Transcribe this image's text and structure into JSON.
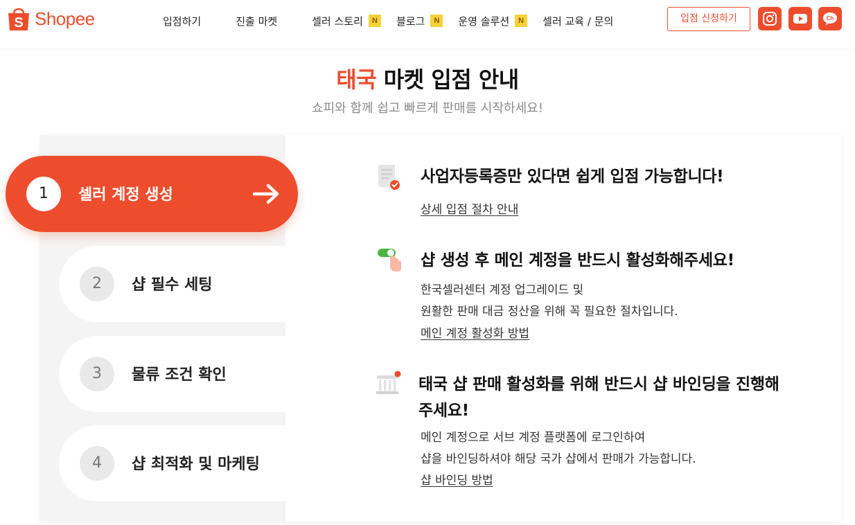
{
  "brand": {
    "name": "Shopee",
    "color": "#ee4d2d"
  },
  "nav": {
    "items": [
      {
        "label": "입점하기",
        "badge": ""
      },
      {
        "label": "진출 마켓",
        "badge": ""
      },
      {
        "label": "셀러 스토리",
        "badge": "N"
      },
      {
        "label": "블로그",
        "badge": "N"
      },
      {
        "label": "운영 솔루션",
        "badge": "N"
      },
      {
        "label": "셀러 교육 / 문의",
        "badge": ""
      }
    ],
    "apply_label": "입점 신청하기",
    "social_icons": [
      "instagram-icon",
      "youtube-icon",
      "kakao-channel-icon"
    ],
    "kakao_label": "Ch"
  },
  "hero": {
    "title_accent": "태국",
    "title_rest": "마켓 입점 안내",
    "subtitle": "쇼피와 함께 쉽고 빠르게 판매를 시작하세요!"
  },
  "steps": [
    {
      "num": "1",
      "label": "셀러 계정 생성",
      "active": true
    },
    {
      "num": "2",
      "label": "샵 필수 세팅",
      "active": false
    },
    {
      "num": "3",
      "label": "물류 조건 확인",
      "active": false
    },
    {
      "num": "4",
      "label": "샵 최적화 및 마케팅",
      "active": false
    }
  ],
  "content": [
    {
      "icon": "document-check-icon",
      "title": "사업자등록증만 있다면 쉽게 입점 가능합니다!",
      "text": [],
      "link": "상세 입점 절차 안내"
    },
    {
      "icon": "toggle-tap-icon",
      "title": "샵 생성 후 메인 계정을 반드시 활성화해주세요!",
      "text": [
        "한국셀러센터 계정 업그레이드 및",
        "원활한 판매 대금 정산을 위해 꼭 필요한 절차입니다."
      ],
      "link": "메인 계정 활성화 방법"
    },
    {
      "icon": "shop-binding-icon",
      "title_lines": [
        "태국 샵 판매 활성화를 위해 반드시 샵 바인딩을 진행해",
        "주세요!"
      ],
      "text": [
        "메인 계정으로 서브 계정 플랫폼에 로그인하여",
        "샵을 바인딩하셔야 해당 국가 샵에서 판매가 가능합니다."
      ],
      "link": "샵 바인딩 방법"
    }
  ]
}
